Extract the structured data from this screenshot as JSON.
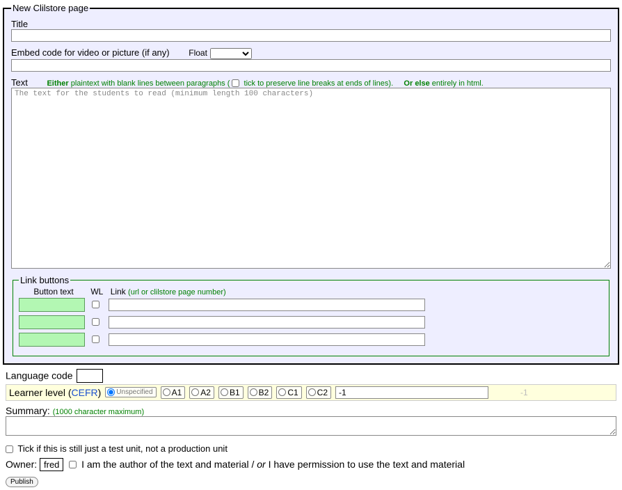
{
  "fieldset_legend": "New Clilstore page",
  "title": {
    "label": "Title",
    "value": ""
  },
  "embed": {
    "label": "Embed code for video or picture (if any)",
    "float_label": "Float",
    "value": ""
  },
  "text": {
    "label": "Text",
    "either": "Either",
    "plaintext_note": " plaintext with blank lines between paragraphs ( ",
    "tick_note": " tick to preserve line breaks at ends of lines).",
    "orelse": "Or else",
    "html_note": " entirely in html.",
    "placeholder": "The text for the students to read (minimum length 100 characters)"
  },
  "linkbuttons": {
    "legend": "Link buttons",
    "header_bt": "Button text",
    "header_wl": "WL",
    "header_link": "Link",
    "header_link_hint": "(url or clilstore page number)",
    "rows": [
      {
        "btn": "",
        "wl": false,
        "link": ""
      },
      {
        "btn": "",
        "wl": false,
        "link": ""
      },
      {
        "btn": "",
        "wl": false,
        "link": ""
      }
    ]
  },
  "langcode": {
    "label": "Language code",
    "value": ""
  },
  "learner": {
    "label_lead": "Learner level (",
    "cefr": "CEFR",
    "label_close": ")",
    "unspecified": "Unspecified",
    "levels": [
      "A1",
      "A2",
      "B1",
      "B2",
      "C1",
      "C2"
    ],
    "num_value": "-1",
    "ghost": "-1"
  },
  "summary": {
    "label": "Summary:",
    "hint": "(1000 character maximum)",
    "value": ""
  },
  "testunit": {
    "label": "Tick if this is still just a test unit, not a production unit"
  },
  "owner": {
    "label": "Owner:",
    "name": "fred",
    "auth_pre": "I am the author of the text and material / ",
    "auth_or": "or",
    "auth_post": " I have permission to use the text and material"
  },
  "publish": "Publish"
}
